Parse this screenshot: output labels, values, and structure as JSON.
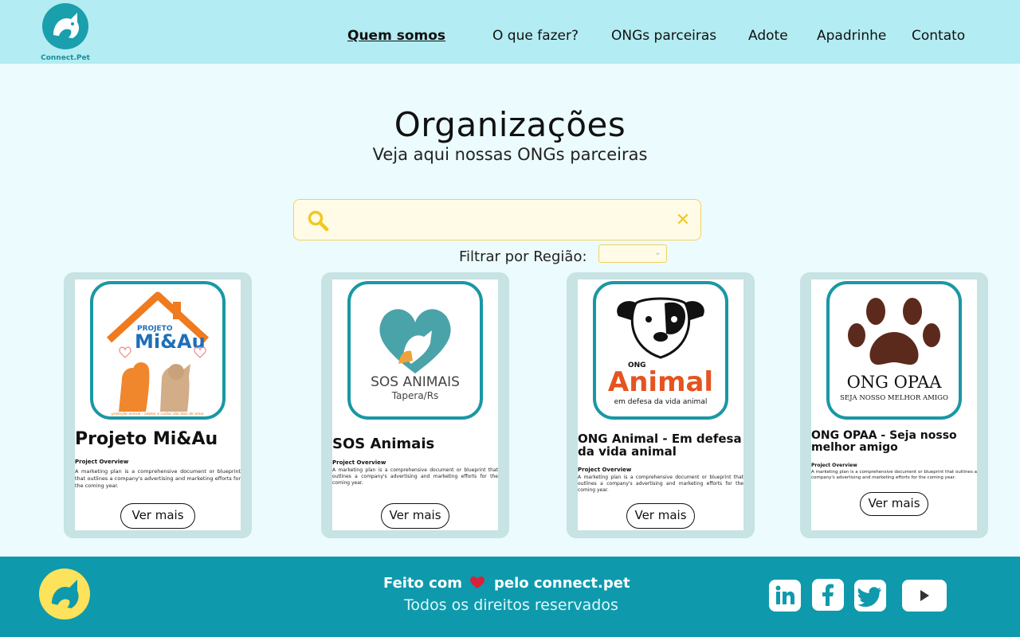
{
  "brand": {
    "name": "Connect.Pet"
  },
  "nav": {
    "items": [
      {
        "label": "Quem somos"
      },
      {
        "label": "O que fazer?"
      },
      {
        "label": "ONGs parceiras"
      },
      {
        "label": "Adote"
      },
      {
        "label": "Apadrinhe"
      },
      {
        "label": "Contato"
      }
    ]
  },
  "main": {
    "title": "Organizações",
    "subtitle": "Veja aqui nossas ONGs parceiras"
  },
  "search": {
    "value": "",
    "placeholder": ""
  },
  "filter": {
    "label": "Filtrar por Região:",
    "selected": ""
  },
  "cards": [
    {
      "name": "Projeto Mi&Au",
      "overview_title": "Project Overview",
      "description": "A marketing plan is a comprehensive document or blueprint that outlines a company's advertising and marketing efforts for the coming year.",
      "button": "Ver mais",
      "logo": {
        "line1": "PROJETO",
        "line2": "Mi&Au",
        "tagline": "proteção animal - adotar e cuidar são atos de amor"
      }
    },
    {
      "name": "SOS Animais",
      "overview_title": "Project Overview",
      "description": "A marketing plan is a comprehensive document or blueprint that outlines a company's advertising and marketing efforts for the coming year.",
      "button": "Ver mais",
      "logo": {
        "line1": "SOS ANIMAIS",
        "line2": "Tapera/Rs"
      }
    },
    {
      "name": "ONG Animal - Em defesa da vida animal",
      "overview_title": "Project Overview",
      "description": "A marketing plan is a comprehensive document or blueprint that outlines a company's advertising and marketing efforts for the coming year.",
      "button": "Ver mais",
      "logo": {
        "line1": "ONG",
        "line2": "Animal",
        "tagline": "em defesa da vida animal"
      }
    },
    {
      "name": "ONG OPAA - Seja nosso melhor amigo",
      "overview_title": "Project Overview",
      "description": "A marketing plan is a comprehensive document or blueprint that outlines a company's advertising and marketing efforts for the coming year.",
      "button": "Ver mais",
      "logo": {
        "line1": "ONG OPAA",
        "tagline": "SEJA NOSSO MELHOR AMIGO"
      }
    }
  ],
  "footer": {
    "made_prefix": "Feito com",
    "made_suffix": "pelo connect.pet",
    "rights": "Todos os direitos reservados",
    "social": [
      {
        "icon": "linkedin-icon"
      },
      {
        "icon": "facebook-icon"
      },
      {
        "icon": "twitter-icon"
      },
      {
        "icon": "youtube-icon"
      }
    ]
  },
  "colors": {
    "header_bg": "#b3ecf2",
    "page_bg": "#ecfbfd",
    "teal": "#0e9aac",
    "accent_yellow": "#fde25b",
    "heart": "#d9213a"
  }
}
